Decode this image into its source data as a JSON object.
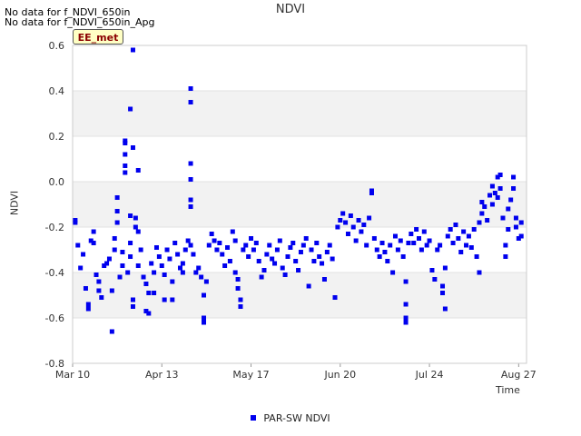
{
  "notices": [
    "No data for f_NDVI_650in",
    "No data for f_NDVI_650in_Apg"
  ],
  "badge": "EE_met",
  "chart_data": {
    "type": "scatter",
    "title": "NDVI",
    "xlabel": "Time",
    "ylabel": "NDVI",
    "ylim": [
      -0.8,
      0.6
    ],
    "xlim": [
      "2020-03-10",
      "2020-08-30"
    ],
    "yticks": [
      -0.8,
      -0.6,
      -0.4,
      -0.2,
      0.0,
      0.2,
      0.4,
      0.6
    ],
    "ytick_labels": [
      "-0.8",
      "-0.6",
      "-0.4",
      "-0.2",
      "0.0",
      "0.2",
      "0.4",
      "0.6"
    ],
    "xticks": [
      "2020-03-10",
      "2020-04-13",
      "2020-05-17",
      "2020-06-20",
      "2020-07-24",
      "2020-08-27"
    ],
    "xtick_labels": [
      "Mar 10",
      "Apr 13",
      "May 17",
      "Jun 20",
      "Jul 24",
      "Aug 27"
    ],
    "grid": "alternating horizontal bands",
    "legend_position": "bottom-center",
    "colors": {
      "series": "#0000ee",
      "band": "#f2f2f2"
    },
    "series": [
      {
        "name": "PAR-SW NDVI",
        "points": [
          [
            "2020-03-11",
            -0.17
          ],
          [
            "2020-03-11",
            -0.18
          ],
          [
            "2020-03-12",
            -0.28
          ],
          [
            "2020-03-13",
            -0.38
          ],
          [
            "2020-03-14",
            -0.32
          ],
          [
            "2020-03-15",
            -0.47
          ],
          [
            "2020-03-16",
            -0.54
          ],
          [
            "2020-03-16",
            -0.56
          ],
          [
            "2020-03-17",
            -0.26
          ],
          [
            "2020-03-18",
            -0.22
          ],
          [
            "2020-03-18",
            -0.27
          ],
          [
            "2020-03-19",
            -0.41
          ],
          [
            "2020-03-20",
            -0.48
          ],
          [
            "2020-03-20",
            -0.44
          ],
          [
            "2020-03-21",
            -0.51
          ],
          [
            "2020-03-22",
            -0.37
          ],
          [
            "2020-03-23",
            -0.36
          ],
          [
            "2020-03-24",
            -0.34
          ],
          [
            "2020-03-25",
            -0.48
          ],
          [
            "2020-03-25",
            -0.66
          ],
          [
            "2020-03-26",
            -0.25
          ],
          [
            "2020-03-26",
            -0.3
          ],
          [
            "2020-03-27",
            -0.07
          ],
          [
            "2020-03-27",
            -0.13
          ],
          [
            "2020-03-27",
            -0.18
          ],
          [
            "2020-03-28",
            -0.42
          ],
          [
            "2020-03-29",
            -0.37
          ],
          [
            "2020-03-29",
            -0.31
          ],
          [
            "2020-03-30",
            0.18
          ],
          [
            "2020-03-30",
            0.17
          ],
          [
            "2020-03-30",
            0.12
          ],
          [
            "2020-03-30",
            0.07
          ],
          [
            "2020-03-30",
            0.04
          ],
          [
            "2020-03-31",
            -0.4
          ],
          [
            "2020-04-01",
            0.32
          ],
          [
            "2020-04-01",
            -0.15
          ],
          [
            "2020-04-01",
            -0.27
          ],
          [
            "2020-04-01",
            -0.33
          ],
          [
            "2020-04-02",
            0.58
          ],
          [
            "2020-04-02",
            0.15
          ],
          [
            "2020-04-02",
            -0.52
          ],
          [
            "2020-04-02",
            -0.55
          ],
          [
            "2020-04-03",
            -0.16
          ],
          [
            "2020-04-03",
            -0.2
          ],
          [
            "2020-04-04",
            0.05
          ],
          [
            "2020-04-04",
            -0.22
          ],
          [
            "2020-04-04",
            -0.37
          ],
          [
            "2020-04-05",
            -0.3
          ],
          [
            "2020-04-06",
            -0.42
          ],
          [
            "2020-04-07",
            -0.45
          ],
          [
            "2020-04-07",
            -0.57
          ],
          [
            "2020-04-08",
            -0.58
          ],
          [
            "2020-04-08",
            -0.49
          ],
          [
            "2020-04-09",
            -0.36
          ],
          [
            "2020-04-10",
            -0.4
          ],
          [
            "2020-04-10",
            -0.49
          ],
          [
            "2020-04-11",
            -0.29
          ],
          [
            "2020-04-12",
            -0.33
          ],
          [
            "2020-04-13",
            -0.37
          ],
          [
            "2020-04-14",
            -0.52
          ],
          [
            "2020-04-14",
            -0.41
          ],
          [
            "2020-04-15",
            -0.3
          ],
          [
            "2020-04-16",
            -0.34
          ],
          [
            "2020-04-17",
            -0.44
          ],
          [
            "2020-04-17",
            -0.52
          ],
          [
            "2020-04-18",
            -0.27
          ],
          [
            "2020-04-19",
            -0.32
          ],
          [
            "2020-04-20",
            -0.38
          ],
          [
            "2020-04-21",
            -0.36
          ],
          [
            "2020-04-21",
            -0.4
          ],
          [
            "2020-04-22",
            -0.3
          ],
          [
            "2020-04-23",
            -0.26
          ],
          [
            "2020-04-24",
            0.41
          ],
          [
            "2020-04-24",
            0.35
          ],
          [
            "2020-04-24",
            0.08
          ],
          [
            "2020-04-24",
            0.01
          ],
          [
            "2020-04-24",
            -0.08
          ],
          [
            "2020-04-24",
            -0.11
          ],
          [
            "2020-04-24",
            -0.28
          ],
          [
            "2020-04-25",
            -0.32
          ],
          [
            "2020-04-26",
            -0.4
          ],
          [
            "2020-04-27",
            -0.38
          ],
          [
            "2020-04-28",
            -0.42
          ],
          [
            "2020-04-29",
            -0.5
          ],
          [
            "2020-04-29",
            -0.6
          ],
          [
            "2020-04-29",
            -0.62
          ],
          [
            "2020-04-30",
            -0.44
          ],
          [
            "2020-05-01",
            -0.28
          ],
          [
            "2020-05-02",
            -0.23
          ],
          [
            "2020-05-03",
            -0.26
          ],
          [
            "2020-05-04",
            -0.3
          ],
          [
            "2020-05-05",
            -0.27
          ],
          [
            "2020-05-06",
            -0.32
          ],
          [
            "2020-05-07",
            -0.37
          ],
          [
            "2020-05-08",
            -0.29
          ],
          [
            "2020-05-09",
            -0.35
          ],
          [
            "2020-05-10",
            -0.22
          ],
          [
            "2020-05-11",
            -0.26
          ],
          [
            "2020-05-11",
            -0.4
          ],
          [
            "2020-05-12",
            -0.43
          ],
          [
            "2020-05-12",
            -0.47
          ],
          [
            "2020-05-13",
            -0.52
          ],
          [
            "2020-05-13",
            -0.55
          ],
          [
            "2020-05-14",
            -0.3
          ],
          [
            "2020-05-15",
            -0.28
          ],
          [
            "2020-05-16",
            -0.33
          ],
          [
            "2020-05-17",
            -0.25
          ],
          [
            "2020-05-18",
            -0.3
          ],
          [
            "2020-05-19",
            -0.27
          ],
          [
            "2020-05-20",
            -0.35
          ],
          [
            "2020-05-21",
            -0.42
          ],
          [
            "2020-05-22",
            -0.39
          ],
          [
            "2020-05-23",
            -0.32
          ],
          [
            "2020-05-24",
            -0.28
          ],
          [
            "2020-05-25",
            -0.34
          ],
          [
            "2020-05-26",
            -0.36
          ],
          [
            "2020-05-27",
            -0.3
          ],
          [
            "2020-05-28",
            -0.26
          ],
          [
            "2020-05-29",
            -0.38
          ],
          [
            "2020-05-30",
            -0.41
          ],
          [
            "2020-05-31",
            -0.33
          ],
          [
            "2020-06-01",
            -0.29
          ],
          [
            "2020-06-02",
            -0.27
          ],
          [
            "2020-06-03",
            -0.35
          ],
          [
            "2020-06-04",
            -0.39
          ],
          [
            "2020-06-05",
            -0.31
          ],
          [
            "2020-06-06",
            -0.28
          ],
          [
            "2020-06-07",
            -0.25
          ],
          [
            "2020-06-08",
            -0.46
          ],
          [
            "2020-06-09",
            -0.3
          ],
          [
            "2020-06-10",
            -0.35
          ],
          [
            "2020-06-11",
            -0.27
          ],
          [
            "2020-06-12",
            -0.33
          ],
          [
            "2020-06-13",
            -0.36
          ],
          [
            "2020-06-14",
            -0.43
          ],
          [
            "2020-06-15",
            -0.31
          ],
          [
            "2020-06-16",
            -0.28
          ],
          [
            "2020-06-17",
            -0.34
          ],
          [
            "2020-06-18",
            -0.51
          ],
          [
            "2020-06-19",
            -0.2
          ],
          [
            "2020-06-20",
            -0.17
          ],
          [
            "2020-06-21",
            -0.14
          ],
          [
            "2020-06-22",
            -0.18
          ],
          [
            "2020-06-23",
            -0.23
          ],
          [
            "2020-06-24",
            -0.15
          ],
          [
            "2020-06-25",
            -0.2
          ],
          [
            "2020-06-26",
            -0.26
          ],
          [
            "2020-06-27",
            -0.17
          ],
          [
            "2020-06-28",
            -0.22
          ],
          [
            "2020-06-29",
            -0.19
          ],
          [
            "2020-06-30",
            -0.28
          ],
          [
            "2020-07-01",
            -0.16
          ],
          [
            "2020-07-02",
            -0.05
          ],
          [
            "2020-07-02",
            -0.04
          ],
          [
            "2020-07-03",
            -0.25
          ],
          [
            "2020-07-04",
            -0.3
          ],
          [
            "2020-07-05",
            -0.33
          ],
          [
            "2020-07-06",
            -0.27
          ],
          [
            "2020-07-07",
            -0.31
          ],
          [
            "2020-07-08",
            -0.35
          ],
          [
            "2020-07-09",
            -0.28
          ],
          [
            "2020-07-10",
            -0.4
          ],
          [
            "2020-07-11",
            -0.24
          ],
          [
            "2020-07-12",
            -0.3
          ],
          [
            "2020-07-13",
            -0.26
          ],
          [
            "2020-07-14",
            -0.33
          ],
          [
            "2020-07-15",
            -0.44
          ],
          [
            "2020-07-15",
            -0.54
          ],
          [
            "2020-07-15",
            -0.6
          ],
          [
            "2020-07-15",
            -0.62
          ],
          [
            "2020-07-16",
            -0.27
          ],
          [
            "2020-07-17",
            -0.23
          ],
          [
            "2020-07-18",
            -0.27
          ],
          [
            "2020-07-19",
            -0.21
          ],
          [
            "2020-07-20",
            -0.25
          ],
          [
            "2020-07-21",
            -0.3
          ],
          [
            "2020-07-22",
            -0.22
          ],
          [
            "2020-07-23",
            -0.28
          ],
          [
            "2020-07-24",
            -0.26
          ],
          [
            "2020-07-25",
            -0.39
          ],
          [
            "2020-07-26",
            -0.43
          ],
          [
            "2020-07-27",
            -0.3
          ],
          [
            "2020-07-28",
            -0.28
          ],
          [
            "2020-07-29",
            -0.46
          ],
          [
            "2020-07-29",
            -0.49
          ],
          [
            "2020-07-30",
            -0.56
          ],
          [
            "2020-07-30",
            -0.38
          ],
          [
            "2020-07-31",
            -0.24
          ],
          [
            "2020-08-01",
            -0.21
          ],
          [
            "2020-08-02",
            -0.27
          ],
          [
            "2020-08-03",
            -0.19
          ],
          [
            "2020-08-04",
            -0.25
          ],
          [
            "2020-08-05",
            -0.31
          ],
          [
            "2020-08-06",
            -0.22
          ],
          [
            "2020-08-07",
            -0.28
          ],
          [
            "2020-08-08",
            -0.24
          ],
          [
            "2020-08-09",
            -0.29
          ],
          [
            "2020-08-10",
            -0.21
          ],
          [
            "2020-08-11",
            -0.33
          ],
          [
            "2020-08-12",
            -0.4
          ],
          [
            "2020-08-12",
            -0.18
          ],
          [
            "2020-08-13",
            -0.09
          ],
          [
            "2020-08-13",
            -0.14
          ],
          [
            "2020-08-14",
            -0.11
          ],
          [
            "2020-08-15",
            -0.17
          ],
          [
            "2020-08-16",
            -0.06
          ],
          [
            "2020-08-17",
            -0.02
          ],
          [
            "2020-08-17",
            -0.1
          ],
          [
            "2020-08-18",
            -0.05
          ],
          [
            "2020-08-19",
            0.02
          ],
          [
            "2020-08-19",
            -0.07
          ],
          [
            "2020-08-20",
            0.03
          ],
          [
            "2020-08-20",
            -0.03
          ],
          [
            "2020-08-21",
            -0.16
          ],
          [
            "2020-08-22",
            -0.28
          ],
          [
            "2020-08-22",
            -0.33
          ],
          [
            "2020-08-23",
            -0.21
          ],
          [
            "2020-08-23",
            -0.12
          ],
          [
            "2020-08-24",
            -0.08
          ],
          [
            "2020-08-25",
            0.02
          ],
          [
            "2020-08-25",
            -0.03
          ],
          [
            "2020-08-26",
            -0.16
          ],
          [
            "2020-08-26",
            -0.2
          ],
          [
            "2020-08-27",
            -0.25
          ],
          [
            "2020-08-28",
            -0.18
          ],
          [
            "2020-08-28",
            -0.24
          ]
        ]
      }
    ]
  }
}
